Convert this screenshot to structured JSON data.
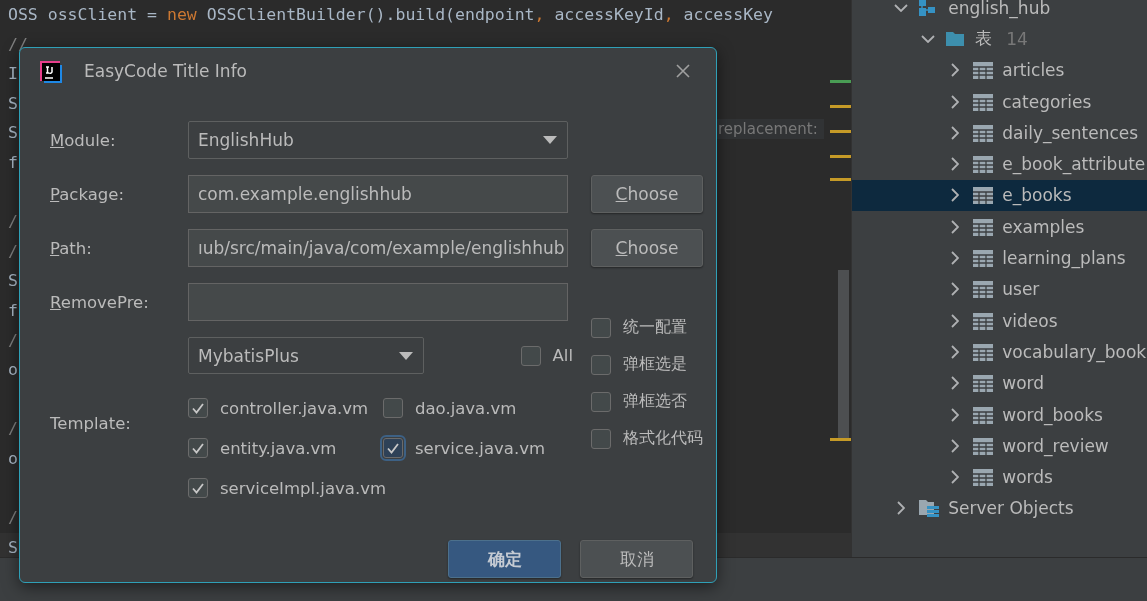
{
  "editor": {
    "lines": [
      [
        {
          "text": "OSS ossClient = ",
          "kind": "plain"
        },
        {
          "text": "new",
          "kind": "keyword"
        },
        {
          "text": " OSSClientBuilder().build(endpoint",
          "kind": "plain"
        },
        {
          "text": ",",
          "kind": "keyword"
        },
        {
          "text": " accessKeyId",
          "kind": "plain"
        },
        {
          "text": ",",
          "kind": "keyword"
        },
        {
          "text": " accessKey",
          "kind": "plain"
        }
      ],
      [
        {
          "text": "//",
          "kind": "comment"
        }
      ],
      [
        {
          "text": "I",
          "kind": "plain"
        }
      ],
      [
        {
          "text": "S",
          "kind": "plain"
        }
      ],
      [
        {
          "text": "S",
          "kind": "plain"
        }
      ],
      [
        {
          "text": "f",
          "kind": "plain"
        }
      ],
      [
        {
          "kind": "blank"
        }
      ],
      [
        {
          "text": "/",
          "kind": "comment"
        }
      ],
      [
        {
          "text": "/",
          "kind": "comment"
        }
      ],
      [
        {
          "text": "S",
          "kind": "plain"
        }
      ],
      [
        {
          "text": "f",
          "kind": "plain"
        }
      ],
      [
        {
          "text": "/",
          "kind": "comment"
        }
      ],
      [
        {
          "text": "o",
          "kind": "plain"
        }
      ],
      [
        {
          "kind": "blank"
        }
      ],
      [
        {
          "text": "/",
          "kind": "comment"
        }
      ],
      [
        {
          "text": "o",
          "kind": "plain"
        }
      ],
      [
        {
          "kind": "blank"
        }
      ],
      [
        {
          "text": "/",
          "kind": "comment"
        }
      ],
      [
        {
          "text": "S",
          "kind": "plain"
        }
      ]
    ],
    "hint": "replacement:"
  },
  "tree": {
    "items": [
      {
        "label": "english_hub",
        "kind": "database",
        "expanded": true,
        "selected": false,
        "children": [
          {
            "label": "表",
            "count": "14",
            "kind": "folder",
            "expanded": true,
            "selected": false,
            "children": [
              {
                "label": "articles",
                "kind": "table",
                "expanded": false,
                "selected": false
              },
              {
                "label": "categories",
                "kind": "table",
                "expanded": false,
                "selected": false
              },
              {
                "label": "daily_sentences",
                "kind": "table",
                "expanded": false,
                "selected": false
              },
              {
                "label": "e_book_attribute",
                "kind": "table",
                "expanded": false,
                "selected": false
              },
              {
                "label": "e_books",
                "kind": "table",
                "expanded": false,
                "selected": true
              },
              {
                "label": "examples",
                "kind": "table",
                "expanded": false,
                "selected": false
              },
              {
                "label": "learning_plans",
                "kind": "table",
                "expanded": false,
                "selected": false
              },
              {
                "label": "user",
                "kind": "table",
                "expanded": false,
                "selected": false
              },
              {
                "label": "videos",
                "kind": "table",
                "expanded": false,
                "selected": false
              },
              {
                "label": "vocabulary_book",
                "kind": "table",
                "expanded": false,
                "selected": false
              },
              {
                "label": "word",
                "kind": "table",
                "expanded": false,
                "selected": false
              },
              {
                "label": "word_books",
                "kind": "table",
                "expanded": false,
                "selected": false
              },
              {
                "label": "word_review",
                "kind": "table",
                "expanded": false,
                "selected": false
              },
              {
                "label": "words",
                "kind": "table",
                "expanded": false,
                "selected": false
              }
            ]
          }
        ]
      },
      {
        "label": "Server Objects",
        "kind": "server",
        "expanded": false,
        "selected": false
      }
    ]
  },
  "dialog": {
    "title": "EasyCode Title Info",
    "fields": [
      {
        "label": "Module",
        "colon": ":",
        "kind": "dropdown",
        "value": "EnglishHub",
        "mnemonic": true
      },
      {
        "label": "Package",
        "colon": ":",
        "kind": "text",
        "value": "com.example.englishhub",
        "button": "Choose",
        "mnemonic": true
      },
      {
        "label": "Path",
        "colon": ":",
        "kind": "text",
        "value": "ıub/src/main/java/com/example/englishhub",
        "button": "Choose",
        "mnemonic": true
      },
      {
        "label": "RemovePre",
        "colon": ":",
        "kind": "text",
        "mnemonic": true
      }
    ],
    "template": {
      "label": "Template:",
      "group": "MybatisPlus",
      "all": {
        "label": "All",
        "checked": false
      },
      "files": [
        {
          "label": "controller.java.vm",
          "checked": true,
          "focused": false
        },
        {
          "label": "dao.java.vm",
          "checked": false,
          "focused": false
        },
        {
          "label": "entity.java.vm",
          "checked": true,
          "focused": false
        },
        {
          "label": "service.java.vm",
          "checked": true,
          "focused": true
        },
        {
          "label": "serviceImpl.java.vm",
          "checked": true,
          "focused": false
        }
      ],
      "options": [
        {
          "label": "统一配置",
          "checked": false
        },
        {
          "label": "弹框选是",
          "checked": false
        },
        {
          "label": "弹框选否",
          "checked": false
        },
        {
          "label": "格式化代码",
          "checked": false
        }
      ]
    },
    "buttons": [
      {
        "label": "确定",
        "kind": "default"
      },
      {
        "label": "取消",
        "kind": "normal"
      }
    ]
  }
}
